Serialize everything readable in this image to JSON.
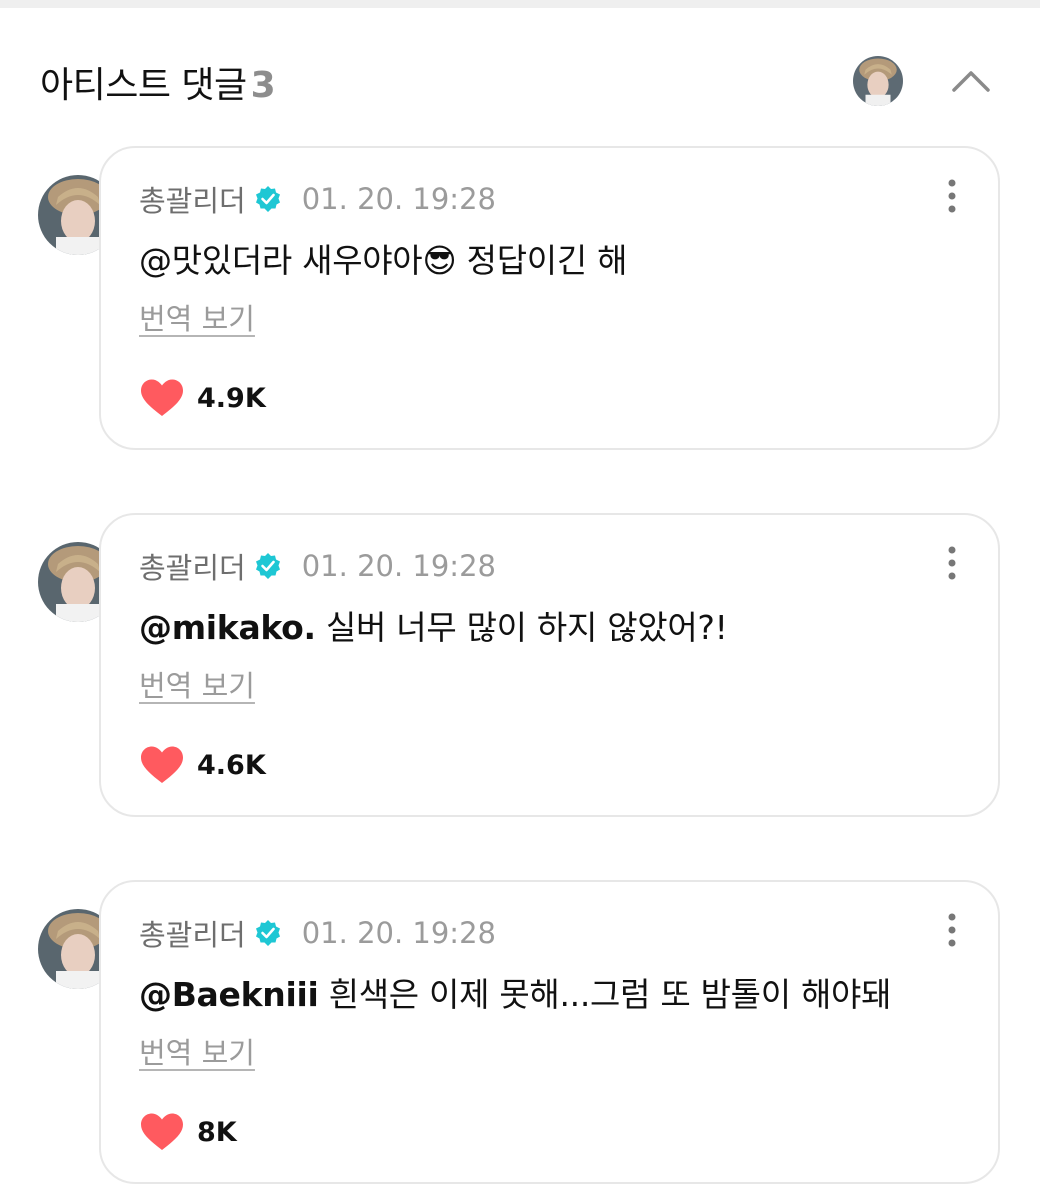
{
  "header": {
    "title": "아티스트 댓글",
    "count": "3"
  },
  "comments": [
    {
      "author": "총괄리더",
      "timestamp": "01. 20. 19:28",
      "mention": "@맛있더라 새우야아😎",
      "text": " 정답이긴 해",
      "translate_label": "번역 보기",
      "likes": "4.9K"
    },
    {
      "author": "총괄리더",
      "timestamp": "01. 20. 19:28",
      "mention": "@mikako.",
      "text": " 실버 너무 많이 하지 않았어?!",
      "translate_label": "번역 보기",
      "likes": "4.6K"
    },
    {
      "author": "총괄리더",
      "timestamp": "01. 20. 19:28",
      "mention": "@Baekniii",
      "text": " 흰색은 이제 못해...그럼 또 밤톨이 해야돼",
      "translate_label": "번역 보기",
      "likes": "8K"
    }
  ],
  "colors": {
    "verified": "#1ec7d4",
    "heart": "#ff5a5f",
    "card_border": "#e7e7e7",
    "muted_text": "#9b9b9b"
  },
  "icons": [
    "verified-badge-icon",
    "more-vertical-icon",
    "heart-icon",
    "chevron-up-icon"
  ]
}
